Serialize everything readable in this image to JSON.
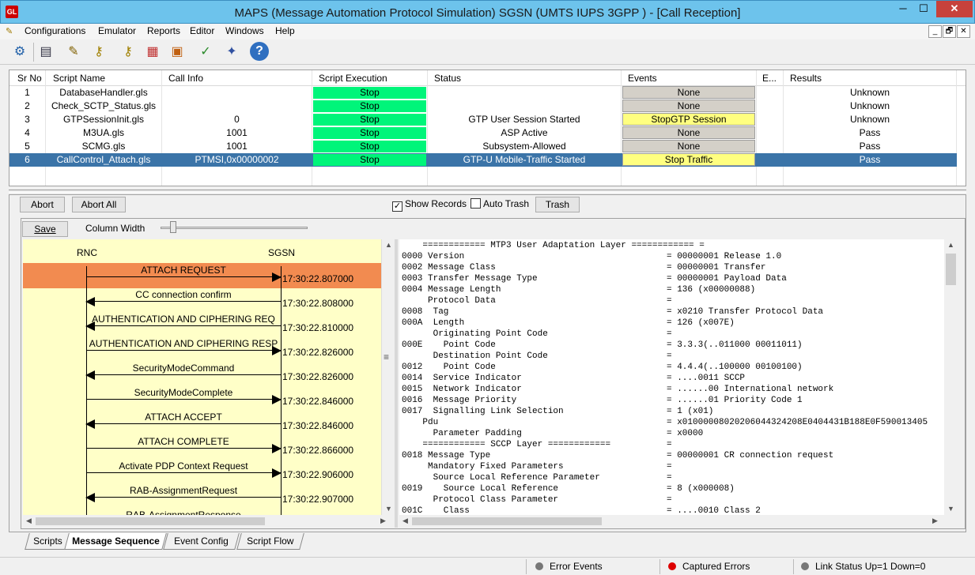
{
  "window": {
    "title": "MAPS (Message Automation Protocol Simulation) SGSN (UMTS IUPS 3GPP ) - [Call Reception]",
    "icon_text": "GL",
    "min": "─",
    "max": "☐",
    "close": "✕"
  },
  "menu": {
    "items": [
      "Configurations",
      "Emulator",
      "Reports",
      "Editor",
      "Windows",
      "Help"
    ],
    "mdi": [
      "_",
      "🗗",
      "✕"
    ]
  },
  "toolbar": {
    "icons": [
      "gear-icon",
      "notebook-icon",
      "script-edit-icon",
      "keys-icon",
      "keys-alt-icon",
      "profiles-icon",
      "briefcase-icon",
      "checklist-icon",
      "wizard-icon",
      "help-icon"
    ],
    "glyphs": [
      "⚙",
      "▤",
      "✎",
      "⚷",
      "⚷",
      "▦",
      "▣",
      "✓",
      "✦",
      "?"
    ]
  },
  "scripts_grid": {
    "columns": [
      "Sr No",
      "Script Name",
      "Call Info",
      "Script Execution",
      "Status",
      "Events",
      "E...",
      "Results"
    ],
    "rows": [
      {
        "sr": "1",
        "name": "DatabaseHandler.gls",
        "call_info": "",
        "exec": "Stop",
        "status": "",
        "event": "None",
        "event_style": "gray",
        "result": "Unknown"
      },
      {
        "sr": "2",
        "name": "Check_SCTP_Status.gls",
        "call_info": "",
        "exec": "Stop",
        "status": "",
        "event": "None",
        "event_style": "gray",
        "result": "Unknown"
      },
      {
        "sr": "3",
        "name": "GTPSessionInit.gls",
        "call_info": "0",
        "exec": "Stop",
        "status": "GTP User Session Started",
        "event": "StopGTP Session",
        "event_style": "yellow",
        "result": "Unknown"
      },
      {
        "sr": "4",
        "name": "M3UA.gls",
        "call_info": "1001",
        "exec": "Stop",
        "status": "ASP Active",
        "event": "None",
        "event_style": "gray",
        "result": "Pass"
      },
      {
        "sr": "5",
        "name": "SCMG.gls",
        "call_info": "1001",
        "exec": "Stop",
        "status": "Subsystem-Allowed",
        "event": "None",
        "event_style": "gray",
        "result": "Pass"
      },
      {
        "sr": "6",
        "name": "CallControl_Attach.gls",
        "call_info": "PTMSI,0x00000002",
        "exec": "Stop",
        "status": "GTP-U Mobile-Traffic Started",
        "event": "Stop Traffic",
        "event_style": "yellow",
        "result": "Pass",
        "selected": true
      }
    ]
  },
  "controls": {
    "abort": "Abort",
    "abort_all": "Abort All",
    "show_records": "Show Records",
    "show_records_checked": true,
    "auto_trash": "Auto Trash",
    "auto_trash_checked": false,
    "trash": "Trash",
    "save": "Save",
    "column_width": "Column Width",
    "checkmark": "✓"
  },
  "sequence": {
    "entities": [
      "RNC",
      "SGSN"
    ],
    "messages": [
      {
        "label": "ATTACH REQUEST",
        "dir": "right",
        "time": "17:30:22.807000",
        "highlight": true
      },
      {
        "label": "CC connection confirm",
        "dir": "left",
        "time": "17:30:22.808000"
      },
      {
        "label": "AUTHENTICATION AND CIPHERING REQ",
        "dir": "left",
        "time": "17:30:22.810000"
      },
      {
        "label": "AUTHENTICATION AND CIPHERING RESP",
        "dir": "right",
        "time": "17:30:22.826000"
      },
      {
        "label": "SecurityModeCommand",
        "dir": "left",
        "time": "17:30:22.826000"
      },
      {
        "label": "SecurityModeComplete",
        "dir": "right",
        "time": "17:30:22.846000"
      },
      {
        "label": "ATTACH ACCEPT",
        "dir": "left",
        "time": "17:30:22.846000"
      },
      {
        "label": "ATTACH COMPLETE",
        "dir": "right",
        "time": "17:30:22.866000"
      },
      {
        "label": "Activate PDP Context Request",
        "dir": "right",
        "time": "17:30:22.906000"
      },
      {
        "label": "RAB-AssignmentRequest",
        "dir": "left",
        "time": "17:30:22.907000"
      },
      {
        "label": "RAB-AssignmentResponse",
        "dir": "right",
        "time": ""
      }
    ]
  },
  "decode": {
    "lines": [
      {
        "f": "    ============ MTP3 User Adaptation Layer ============ =",
        "v": ""
      },
      {
        "f": "0000 Version",
        "v": "= 00000001 Release 1.0"
      },
      {
        "f": "0002 Message Class",
        "v": "= 00000001 Transfer"
      },
      {
        "f": "0003 Transfer Message Type",
        "v": "= 00000001 Payload Data"
      },
      {
        "f": "0004 Message Length",
        "v": "= 136 (x00000088)"
      },
      {
        "f": "     Protocol Data",
        "v": "="
      },
      {
        "f": "0008  Tag",
        "v": "= x0210 Transfer Protocol Data"
      },
      {
        "f": "000A  Length",
        "v": "= 126 (x007E)"
      },
      {
        "f": "      Originating Point Code",
        "v": "="
      },
      {
        "f": "000E    Point Code",
        "v": "= 3.3.3(..011000 00011011)"
      },
      {
        "f": "      Destination Point Code",
        "v": "="
      },
      {
        "f": "0012    Point Code",
        "v": "= 4.4.4(..100000 00100100)"
      },
      {
        "f": "0014  Service Indicator",
        "v": "= ....0011 SCCP"
      },
      {
        "f": "0015  Network Indicator",
        "v": "= ......00 International network"
      },
      {
        "f": "0016  Message Priority",
        "v": "= ......01 Priority Code 1"
      },
      {
        "f": "0017  Signalling Link Selection",
        "v": "= 1 (x01)"
      },
      {
        "f": "    Pdu",
        "v": "= x01000008020206044324208E0404431B188E0F590013405"
      },
      {
        "f": "      Parameter Padding",
        "v": "= x0000"
      },
      {
        "f": "    ============ SCCP Layer ============",
        "v": "="
      },
      {
        "f": "0018 Message Type",
        "v": "= 00000001 CR connection request"
      },
      {
        "f": "     Mandatory Fixed Parameters",
        "v": "="
      },
      {
        "f": "      Source Local Reference Parameter",
        "v": "="
      },
      {
        "f": "0019    Source Local Reference",
        "v": "= 8 (x000008)"
      },
      {
        "f": "      Protocol Class Parameter",
        "v": "="
      },
      {
        "f": "001C    Class",
        "v": "= ....0010 Class 2"
      }
    ]
  },
  "tabs": [
    "Scripts",
    "Message Sequence",
    "Event Config",
    "Script Flow"
  ],
  "active_tab": 1,
  "status": {
    "error_events": "Error Events",
    "captured_errors": "Captured Errors",
    "link_status": "Link Status Up=1 Down=0"
  },
  "colors": {
    "stop_green": "#00f57a",
    "event_yellow": "#ffff80",
    "selected_row": "#3b74a8",
    "highlight_orange": "#f28b50",
    "sequence_bg": "#ffffc8"
  }
}
